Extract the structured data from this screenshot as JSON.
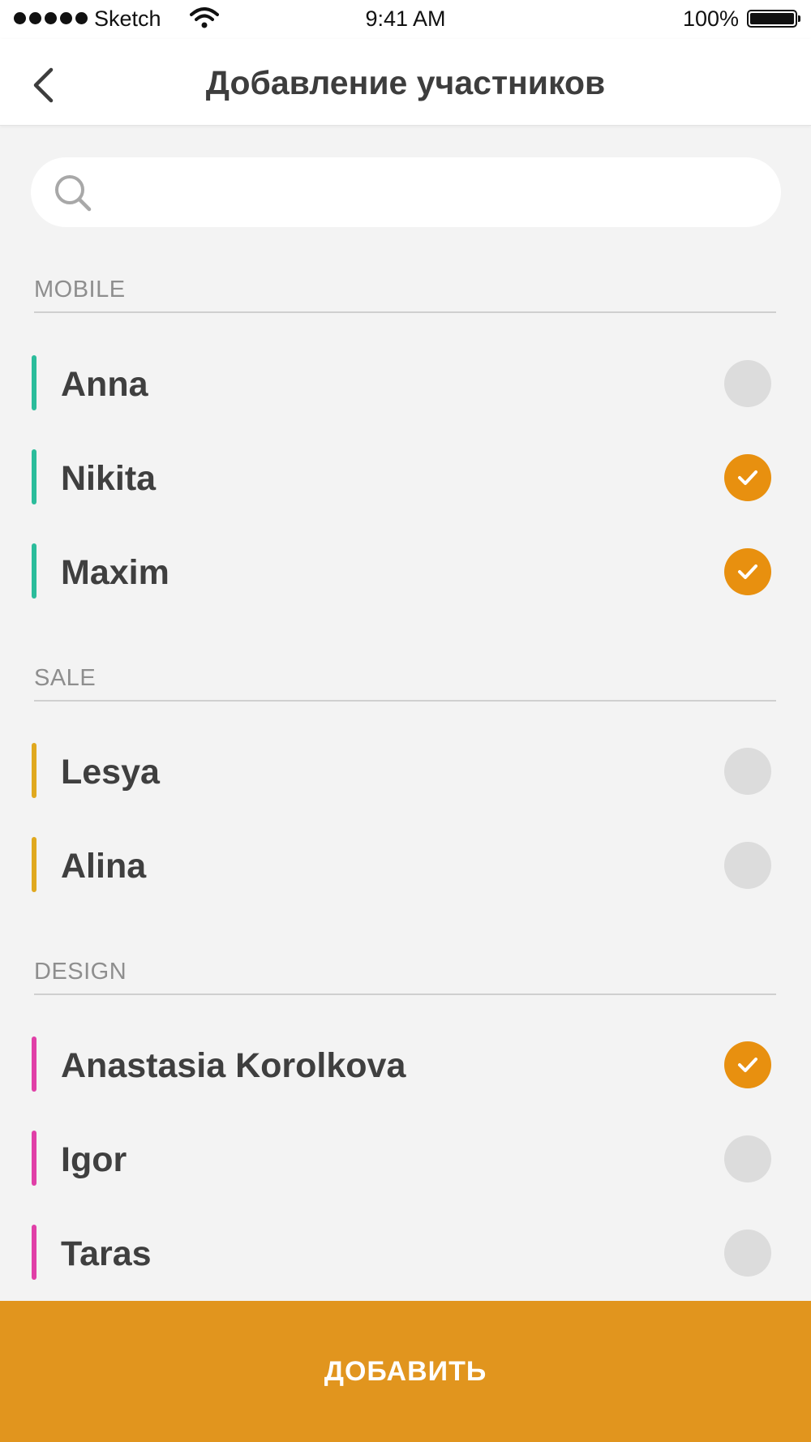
{
  "status_bar": {
    "carrier": "Sketch",
    "time": "9:41 AM",
    "battery": "100%"
  },
  "nav": {
    "title": "Добавление участников",
    "back_icon": "chevron-left-icon"
  },
  "search": {
    "icon": "search-icon",
    "value": "",
    "placeholder": ""
  },
  "colors": {
    "mobile": "#2bbc9b",
    "sale": "#e0a81e",
    "design": "#e03fa7",
    "checked": "#e8900f",
    "unchecked": "#dcdcdc",
    "button": "#e1951e"
  },
  "sections": [
    {
      "label": "MOBILE",
      "color": "#2bbc9b",
      "members": [
        {
          "name": "Anna",
          "selected": false
        },
        {
          "name": "Nikita",
          "selected": true
        },
        {
          "name": "Maxim",
          "selected": true
        }
      ]
    },
    {
      "label": "SALE",
      "color": "#e0a81e",
      "members": [
        {
          "name": "Lesya",
          "selected": false
        },
        {
          "name": "Alina",
          "selected": false
        }
      ]
    },
    {
      "label": "DESIGN",
      "color": "#e03fa7",
      "members": [
        {
          "name": "Anastasia Korolkova",
          "selected": true
        },
        {
          "name": "Igor",
          "selected": false
        },
        {
          "name": "Taras",
          "selected": false
        }
      ]
    }
  ],
  "footer": {
    "add_label": "ДОБАВИТЬ"
  }
}
